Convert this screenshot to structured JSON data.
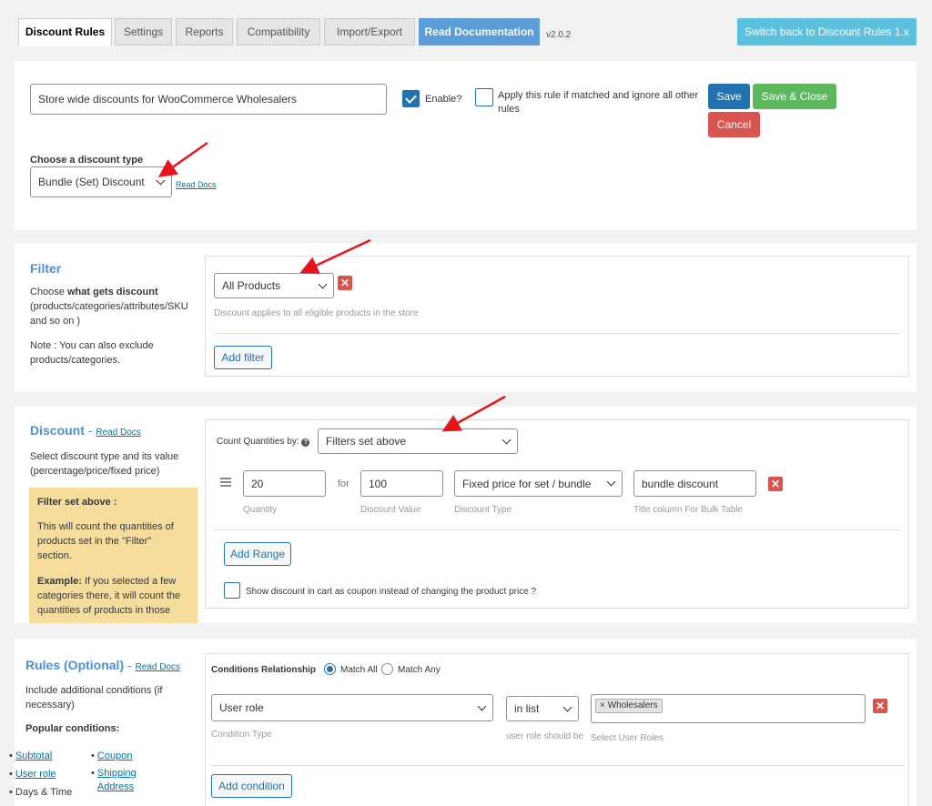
{
  "tabs": [
    "Discount Rules",
    "Settings",
    "Reports",
    "Compatibility",
    "Import/Export"
  ],
  "read_documentation": "Read Documentation",
  "version": "v2.0.2",
  "switch_back": "Switch back to Discount Rules 1.x",
  "rule": {
    "title_value": "Store wide discounts for WooCommerce Wholesalers",
    "enable_label": "Enable?",
    "apply_label": "Apply this rule if matched and ignore all other rules",
    "save": "Save",
    "save_close": "Save & Close",
    "cancel": "Cancel",
    "discount_type_label": "Choose a discount type",
    "discount_type_value": "Bundle (Set) Discount",
    "read_docs": "Read Docs"
  },
  "filter": {
    "title": "Filter",
    "desc_prefix": "Choose ",
    "desc_bold": "what gets discount",
    "desc_rest": "(products/categories/attributes/SKU and so on )",
    "note": "Note : You can also exclude products/categories.",
    "select_value": "All Products",
    "hint": "Discount applies to all eligible products in the store",
    "add_filter": "Add filter"
  },
  "discount": {
    "title": "Discount",
    "dash": " - ",
    "read_docs": "Read Docs",
    "desc": "Select discount type and its value (percentage/price/fixed price)",
    "info_title": "Filter set above :",
    "info_text": "This will count the quantities of products set in the \"Filter\" section.",
    "example_bold": "Example:",
    "example_text": " If you selected a few categories there, it will count the quantities of products in those",
    "count_label": "Count Quantities by:",
    "count_value": "Filters set above",
    "quantity": "20",
    "for_label": "for",
    "discount_value": "100",
    "discount_type": "Fixed price for set / bundle",
    "title_column": "bundle discount",
    "quantity_hint": "Quantity",
    "discount_value_hint": "Discount Value",
    "discount_type_hint": "Discount Type",
    "title_column_hint": "Title column For Bulk Table",
    "add_range": "Add Range",
    "coupon_label": "Show discount in cart as coupon instead of changing the product price ?"
  },
  "rules": {
    "title": "Rules (Optional)",
    "dash": " - ",
    "read_docs": "Read Docs",
    "desc": "Include additional conditions (if necessary)",
    "popular": "Popular conditions:",
    "left_list": [
      "Subtotal",
      "User role",
      "Days & Time"
    ],
    "right_list": [
      "Coupon",
      "Shipping Address"
    ],
    "relationship_label": "Conditions Relationship",
    "match_all": "Match All",
    "match_any": "Match Any",
    "condition_type": "User role",
    "condition_type_hint": "Condition Type",
    "operator": "in list",
    "operator_hint": "user role should be",
    "tag": "Wholesalers",
    "roles_hint": "Select User Roles",
    "add_condition": "Add condition"
  }
}
